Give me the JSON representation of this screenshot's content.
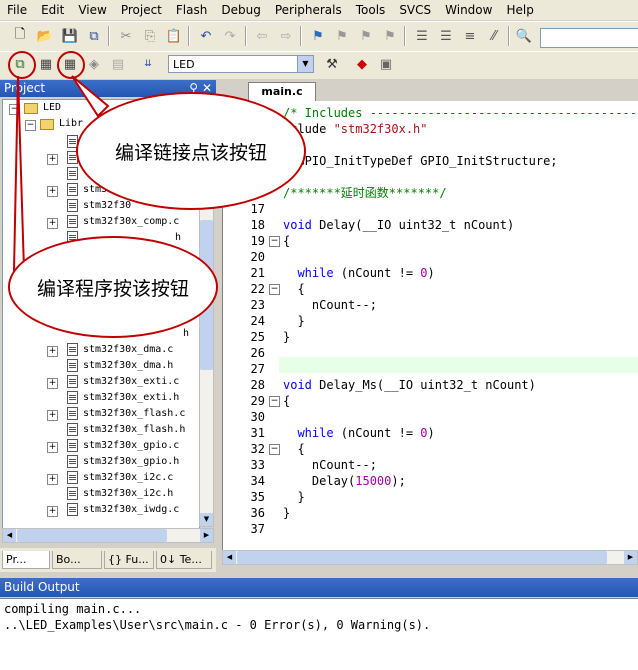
{
  "menu": [
    "File",
    "Edit",
    "View",
    "Project",
    "Flash",
    "Debug",
    "Peripherals",
    "Tools",
    "SVCS",
    "Window",
    "Help"
  ],
  "toolbar": {
    "target": "LED"
  },
  "project": {
    "title": "Project",
    "root": "LED",
    "lib_folder": "Libr",
    "files": [
      "stm32f30x_comp.c",
      "stm32f30x_dma.c",
      "stm32f30x_dma.h",
      "stm32f30x_exti.c",
      "stm32f30x_exti.h",
      "stm32f30x_flash.c",
      "stm32f30x_flash.h",
      "stm32f30x_gpio.c",
      "stm32f30x_gpio.h",
      "stm32f30x_i2c.c",
      "stm32f30x_i2c.h",
      "stm32f30x_iwdg.c"
    ],
    "partial_files": [
      "stm32",
      "stm32f30",
      "h",
      "h"
    ],
    "tabs": [
      "Pr...",
      "Bo...",
      "{} Fu...",
      "0↓ Te..."
    ]
  },
  "editor": {
    "tab": "main.c",
    "lines": [
      {
        "n": "",
        "t": "/* Includes ---------------------------------------------------"
      },
      {
        "n": "",
        "t": "nclude \"stm32f30x.h\""
      },
      {
        "n": "",
        "t": ""
      },
      {
        "n": "",
        "t": "  GPIO_InitTypeDef GPIO_InitStructure;"
      },
      {
        "n": "",
        "t": ""
      },
      {
        "n": "6",
        "t": "/*******延时函数*******/"
      },
      {
        "n": "17",
        "t": ""
      },
      {
        "n": "18",
        "t": "void Delay(__IO uint32_t nCount)"
      },
      {
        "n": "19",
        "t": "{"
      },
      {
        "n": "20",
        "t": ""
      },
      {
        "n": "21",
        "t": "  while (nCount != 0)"
      },
      {
        "n": "22",
        "t": "  {"
      },
      {
        "n": "23",
        "t": "    nCount--;"
      },
      {
        "n": "24",
        "t": "  }"
      },
      {
        "n": "25",
        "t": "}"
      },
      {
        "n": "26",
        "t": ""
      },
      {
        "n": "27",
        "t": ""
      },
      {
        "n": "28",
        "t": "void Delay_Ms(__IO uint32_t nCount)"
      },
      {
        "n": "29",
        "t": "{"
      },
      {
        "n": "30",
        "t": ""
      },
      {
        "n": "31",
        "t": "  while (nCount != 0)"
      },
      {
        "n": "32",
        "t": "  {"
      },
      {
        "n": "33",
        "t": "    nCount--;"
      },
      {
        "n": "34",
        "t": "    Delay(15000);"
      },
      {
        "n": "35",
        "t": "  }"
      },
      {
        "n": "36",
        "t": "}"
      },
      {
        "n": "37",
        "t": ""
      }
    ]
  },
  "build": {
    "title": "Build Output",
    "lines": [
      "compiling main.c...",
      "..\\LED_Examples\\User\\src\\main.c - 0 Error(s), 0 Warning(s)."
    ]
  },
  "annotations": {
    "link": "编译链接点该按钮",
    "compile": "编译程序按该按钮"
  },
  "colors": {
    "annotation": "#c00000",
    "keyword": "#0000ff",
    "string": "#a31515",
    "comment": "#008000",
    "number": "#a000a0"
  }
}
